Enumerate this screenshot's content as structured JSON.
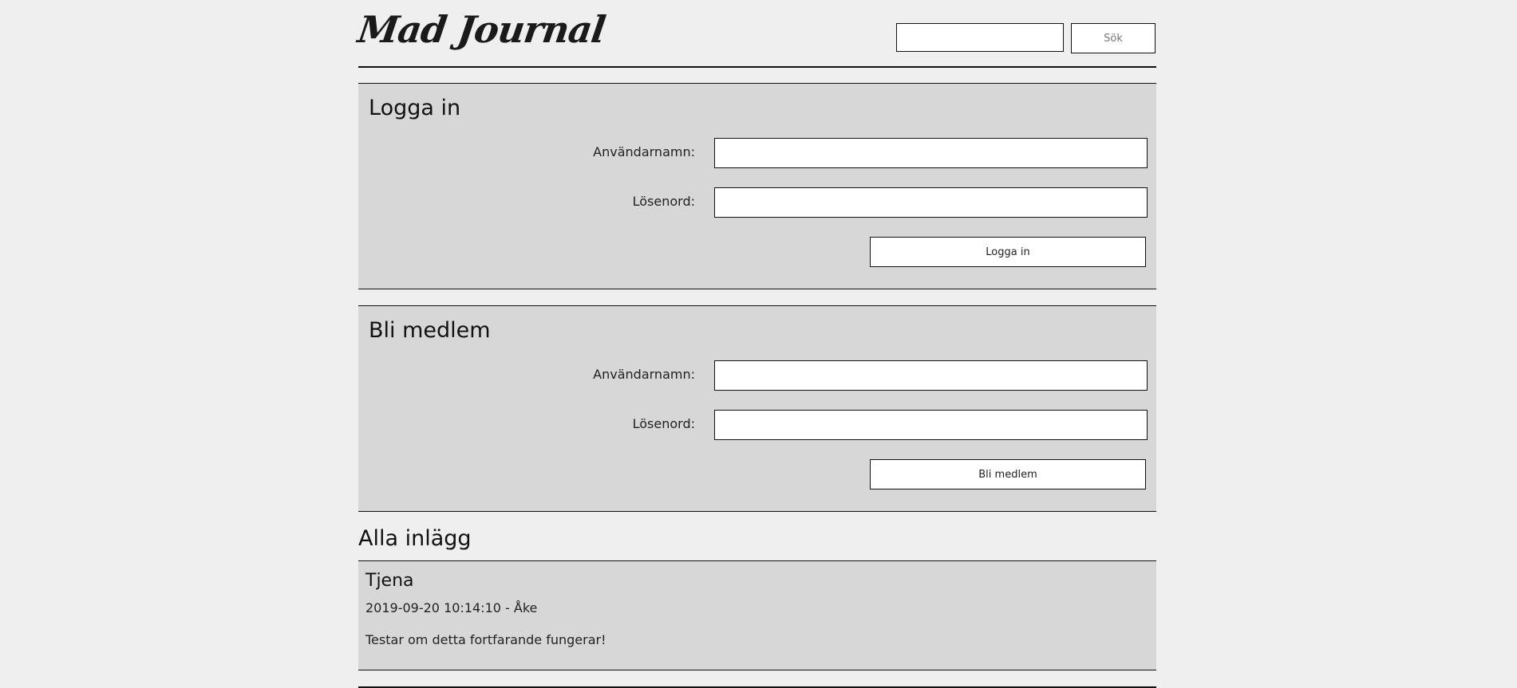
{
  "header": {
    "logo": "Mad Journal",
    "search_value": "",
    "search_button": "Sök"
  },
  "login": {
    "title": "Logga in",
    "username_label": "Användarnamn:",
    "password_label": "Lösenord:",
    "username_value": "",
    "password_value": "",
    "submit": "Logga in"
  },
  "register": {
    "title": "Bli medlem",
    "username_label": "Användarnamn:",
    "password_label": "Lösenord:",
    "username_value": "",
    "password_value": "",
    "submit": "Bli medlem"
  },
  "posts_section": {
    "title": "Alla inlägg",
    "posts": [
      {
        "title": "Tjena",
        "meta": "2019-09-20 10:14:10 - Åke",
        "body": "Testar om detta fortfarande fungerar!"
      }
    ]
  }
}
